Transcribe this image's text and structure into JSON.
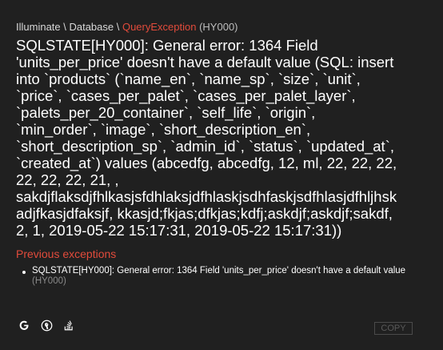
{
  "exception": {
    "namespace_prefix": "Illuminate \\ Database \\ ",
    "class_name": "QueryException",
    "code": "(HY000)",
    "message": "SQLSTATE[HY000]: General error: 1364 Field\n'units_per_price' doesn't have a default value (SQL: insert\ninto `products` (`name_en`, `name_sp`, `size`, `unit`,\n`price`, `cases_per_palet`, `cases_per_palet_layer`,\n`palets_per_20_container`, `self_life`, `origin`,\n`min_order`, `image`, `short_description_en`,\n`short_description_sp`, `admin_id`, `status`, `updated_at`,\n`created_at`) values (abcedfg, abcedfg, 12, ml, 22, 22, 22,\n22, 22, 22, 21, ,\nsakdjflaksdjfhlkasjsfdhlaksjdfhlaskjsdhfaskjsdfhlasjdfhljhsk\nadjfkasjdfaksjf, kkasjd;fkjas;dfkjas;kdfj;askdjf;askdjf;sakdf,\n2, 1, 2019-05-22 15:17:31, 2019-05-22 15:17:31))"
  },
  "previous": {
    "title": "Previous exceptions",
    "items": [
      {
        "message": "SQLSTATE[HY000]: General error: 1364 Field 'units_per_price' doesn't have a default value",
        "code": "(HY000)"
      }
    ]
  },
  "actions": {
    "icons": [
      "google-search-icon",
      "duckduckgo-search-icon",
      "stackoverflow-search-icon"
    ],
    "copy_label": "COPY"
  },
  "colors": {
    "background": "#202020",
    "accent": "#e24b3b",
    "text": "#ffffff",
    "muted": "#8a8a8a"
  }
}
